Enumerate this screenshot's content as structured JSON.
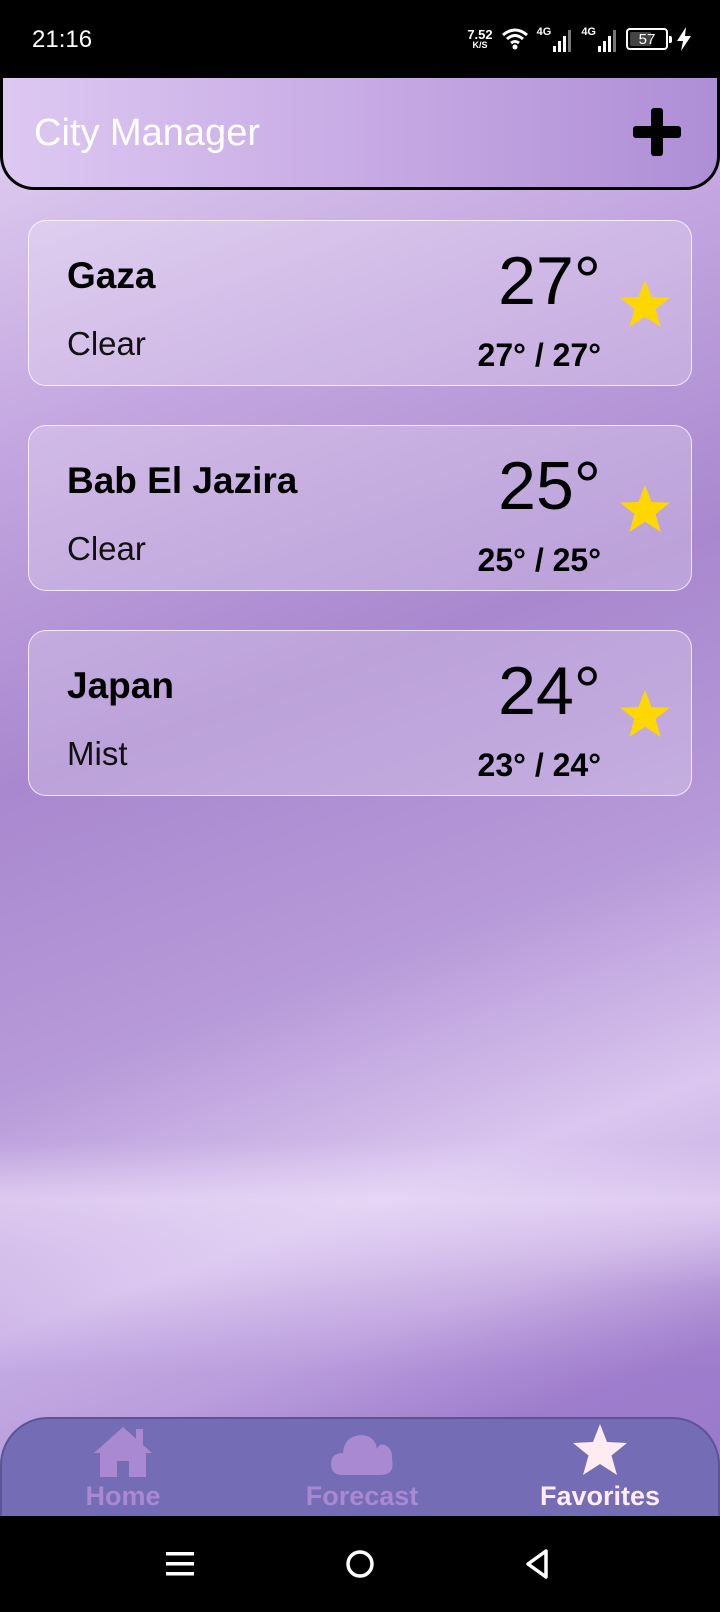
{
  "status_bar": {
    "time": "21:16",
    "speed_value": "7.52",
    "speed_unit": "K/S",
    "network_1": "4G",
    "network_2": "4G",
    "battery_level": "57"
  },
  "header": {
    "title": "City Manager",
    "add_icon": "plus-icon"
  },
  "cities": [
    {
      "name": "Gaza",
      "condition": "Clear",
      "temp": "27°",
      "range": "27° / 27°",
      "favorite": true
    },
    {
      "name": "Bab El Jazira",
      "condition": "Clear",
      "temp": "25°",
      "range": "25° / 25°",
      "favorite": true
    },
    {
      "name": "Japan",
      "condition": "Mist",
      "temp": "24°",
      "range": "23° / 24°",
      "favorite": true
    }
  ],
  "bottom_nav": {
    "items": [
      {
        "label": "Home",
        "icon": "home-icon",
        "active": false
      },
      {
        "label": "Forecast",
        "icon": "cloud-icon",
        "active": false
      },
      {
        "label": "Favorites",
        "icon": "star-icon",
        "active": true
      }
    ]
  },
  "colors": {
    "star": "#ffd700",
    "nav_background": "#746cb4",
    "nav_active": "#ffecf2",
    "nav_muted": "#a889d2"
  }
}
